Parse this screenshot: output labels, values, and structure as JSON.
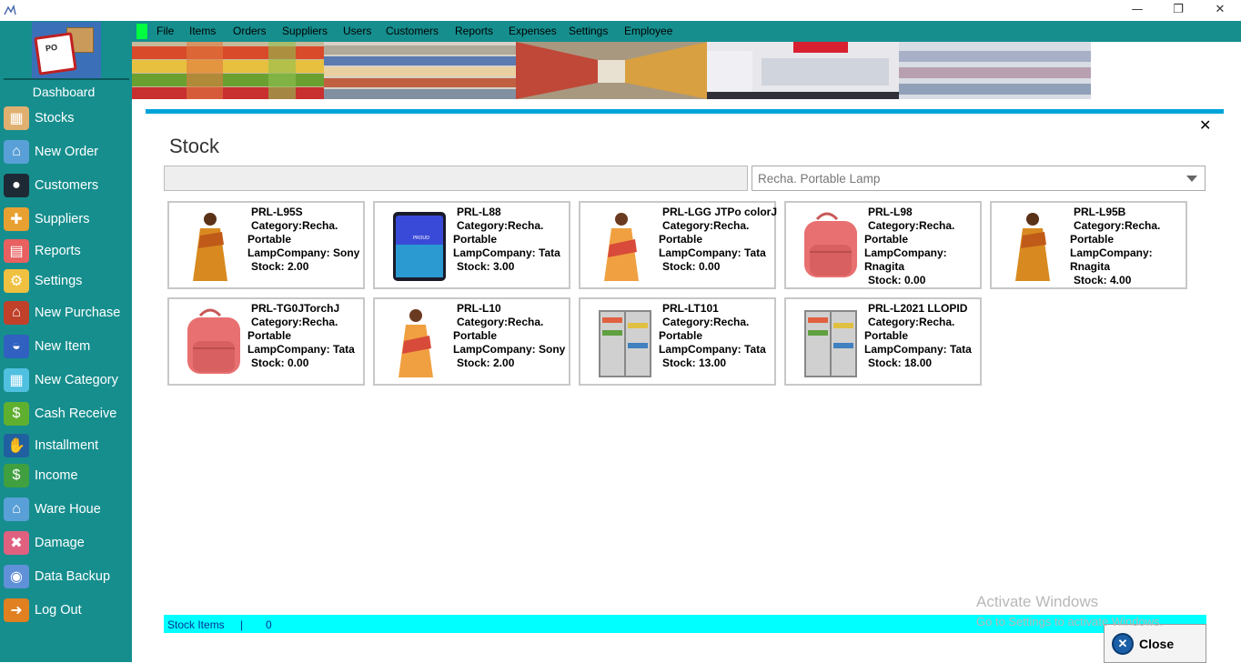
{
  "window": {
    "minimize": "—",
    "restore": "❐",
    "close": "✕"
  },
  "sidebar": {
    "title": "Dashboard",
    "logo_text": "PO",
    "items": [
      {
        "label": "Stocks",
        "icon": "stocks-icon",
        "color": "#e0b070"
      },
      {
        "label": "New Order",
        "icon": "store-icon",
        "color": "#5aa0d8"
      },
      {
        "label": "Customers",
        "icon": "person-icon",
        "color": "#1d2a35"
      },
      {
        "label": "Suppliers",
        "icon": "puzzle-icon",
        "color": "#e8a030"
      },
      {
        "label": "Reports",
        "icon": "report-icon",
        "color": "#e86060"
      },
      {
        "label": "Settings",
        "icon": "settings-icon",
        "color": "#f0c040"
      },
      {
        "label": "New Purchase",
        "icon": "shop-icon",
        "color": "#c0402a"
      },
      {
        "label": "New Item",
        "icon": "basket-icon",
        "color": "#3060c0"
      },
      {
        "label": "New Category",
        "icon": "grid-icon",
        "color": "#50c0e0"
      },
      {
        "label": "Cash Receive",
        "icon": "money-bag-icon",
        "color": "#60b030"
      },
      {
        "label": "Installment",
        "icon": "handshake-icon",
        "color": "#2060a0"
      },
      {
        "label": "Income",
        "icon": "income-icon",
        "color": "#40a040"
      },
      {
        "label": "Ware Houe",
        "icon": "warehouse-icon",
        "color": "#5aa0d8"
      },
      {
        "label": "Damage",
        "icon": "damage-icon",
        "color": "#e06080"
      },
      {
        "label": "Data Backup",
        "icon": "database-icon",
        "color": "#6090d8"
      },
      {
        "label": "Log Out",
        "icon": "logout-icon",
        "color": "#e08020"
      }
    ]
  },
  "menu": {
    "items": [
      "File",
      "Items",
      "Orders",
      "Suppliers",
      "Users",
      "Customers",
      "Reports",
      "Expenses",
      "Settings",
      "Employee"
    ]
  },
  "panel": {
    "title": "Stock",
    "close": "✕",
    "search_value": "",
    "category_selected": "Recha. Portable Lamp"
  },
  "products": [
    {
      "code": "PRL-L95S",
      "line1": "Category:Recha.",
      "line2": "Portable",
      "line3": "LampCompany: Sony",
      "stock": "Stock: 2.00",
      "image": "saree"
    },
    {
      "code": "PRL-L88",
      "line1": "Category:Recha.",
      "line2": "Portable",
      "line3": "LampCompany: Tata",
      "stock": "Stock: 3.00",
      "image": "phone"
    },
    {
      "code": "PRL-LGG JTPo colorJ",
      "line1": "Category:Recha.",
      "line2": "Portable",
      "line3": "LampCompany: Tata",
      "stock": "Stock: 0.00",
      "image": "saree2"
    },
    {
      "code": "PRL-L98",
      "line1": "Category:Recha.",
      "line2": "Portable",
      "line3": "LampCompany:",
      "line4": "Rnagita",
      "stock": "Stock: 0.00",
      "image": "backpack"
    },
    {
      "code": "PRL-L95B",
      "line1": "Category:Recha.",
      "line2": "Portable",
      "line3": "LampCompany:",
      "line4": "Rnagita",
      "stock": "Stock: 4.00",
      "image": "saree"
    },
    {
      "code": "PRL-TG0JTorchJ",
      "line1": "Category:Recha.",
      "line2": "Portable",
      "line3": "LampCompany: Tata",
      "stock": "Stock: 0.00",
      "image": "backpack"
    },
    {
      "code": "PRL-L10",
      "line1": "Category:Recha.",
      "line2": "Portable",
      "line3": "LampCompany: Sony",
      "stock": "Stock: 2.00",
      "image": "saree2"
    },
    {
      "code": "PRL-LT101",
      "line1": "Category:Recha.",
      "line2": "Portable",
      "line3": "LampCompany: Tata",
      "stock": "Stock: 13.00",
      "image": "fridge"
    },
    {
      "code": "PRL-L2021 LLOPID",
      "line1": "Category:Recha.",
      "line2": "Portable",
      "line3": "LampCompany: Tata",
      "stock": "Stock: 18.00",
      "image": "fridge"
    }
  ],
  "status": {
    "label": "Stock Items",
    "separator": "|",
    "count": "0"
  },
  "close_button": {
    "label": "Close"
  },
  "watermark": {
    "line1": "Activate Windows",
    "line2": "Go to Settings to activate Windows."
  }
}
